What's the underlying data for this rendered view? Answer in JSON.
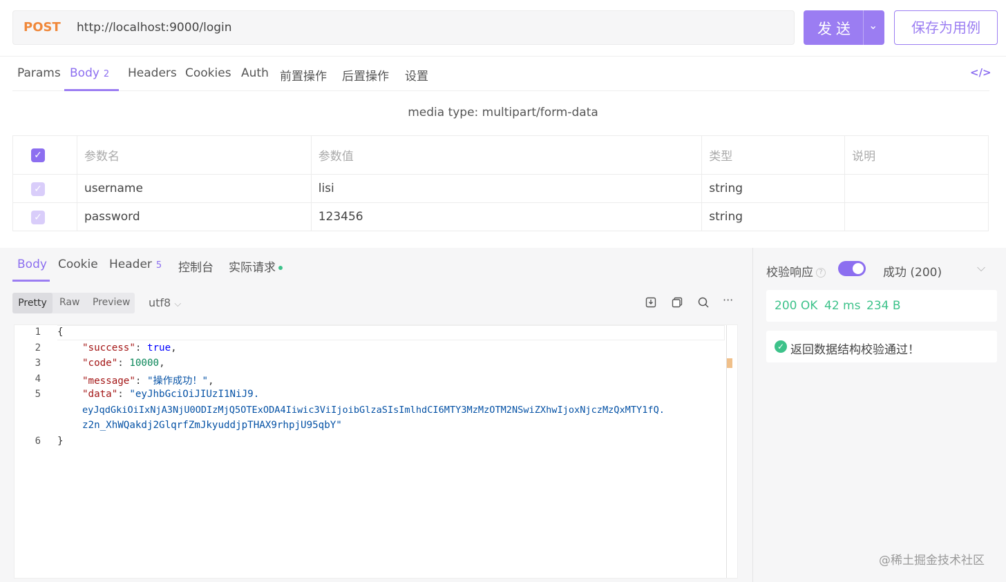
{
  "request": {
    "method": "POST",
    "url": "http://localhost:9000/login",
    "send_label": "发送",
    "save_label": "保存为用例"
  },
  "request_tabs": [
    {
      "label": "Params"
    },
    {
      "label": "Body",
      "count": "2"
    },
    {
      "label": "Headers"
    },
    {
      "label": "Cookies"
    },
    {
      "label": "Auth"
    },
    {
      "label": "前置操作"
    },
    {
      "label": "后置操作"
    },
    {
      "label": "设置"
    }
  ],
  "code_icon": "</>",
  "media_type": "media type: multipart/form-data",
  "params_table": {
    "headers": [
      "参数名",
      "参数值",
      "类型",
      "说明"
    ],
    "rows": [
      {
        "name": "username",
        "value": "lisi",
        "type": "string",
        "desc": ""
      },
      {
        "name": "password",
        "value": "123456",
        "type": "string",
        "desc": ""
      }
    ]
  },
  "response_tabs": [
    {
      "label": "Body"
    },
    {
      "label": "Cookie"
    },
    {
      "label": "Header",
      "count": "5"
    },
    {
      "label": "控制台"
    },
    {
      "label": "实际请求"
    }
  ],
  "view_modes": [
    "Pretty",
    "Raw",
    "Preview"
  ],
  "encoding": "utf8",
  "toolbar_icons": [
    "download-icon",
    "copy-icon",
    "search-icon",
    "more-icon"
  ],
  "code_lines": {
    "l1": "{",
    "l2_key": "\"success\"",
    "l2_val": "true",
    "l3_key": "\"code\"",
    "l3_val": "10000",
    "l4_key": "\"message\"",
    "l4_val": "\"操作成功！\"",
    "l5_key": "\"data\"",
    "l5_val": "\"eyJhbGciOiJIUzI1NiJ9.",
    "l5_cont1": "eyJqdGkiOiIxNjA3NjU0ODIzMjQ5OTExODA4Iiwic3ViIjoibGlzaSIsImlhdCI6MTY3MzMzOTM2NSwiZXhwIjoxNjczMzQxMTY1fQ.",
    "l5_cont2": "z2n_XhWQakdj2GlqrfZmJkyuddjpTHAX9rhpjU95qbY\"",
    "l6": "}"
  },
  "line_numbers": [
    "1",
    "2",
    "3",
    "4",
    "5",
    "6"
  ],
  "validation": {
    "label": "校验响应",
    "enabled": true,
    "status_select": "成功 (200)",
    "status_code": "200 OK",
    "time": "42 ms",
    "size": "234 B",
    "result": "返回数据结构校验通过！"
  },
  "watermark": "@稀土掘金技术社区",
  "colors": {
    "accent": "#9b7df2",
    "method": "#f0883a",
    "success": "#3dc28a"
  }
}
